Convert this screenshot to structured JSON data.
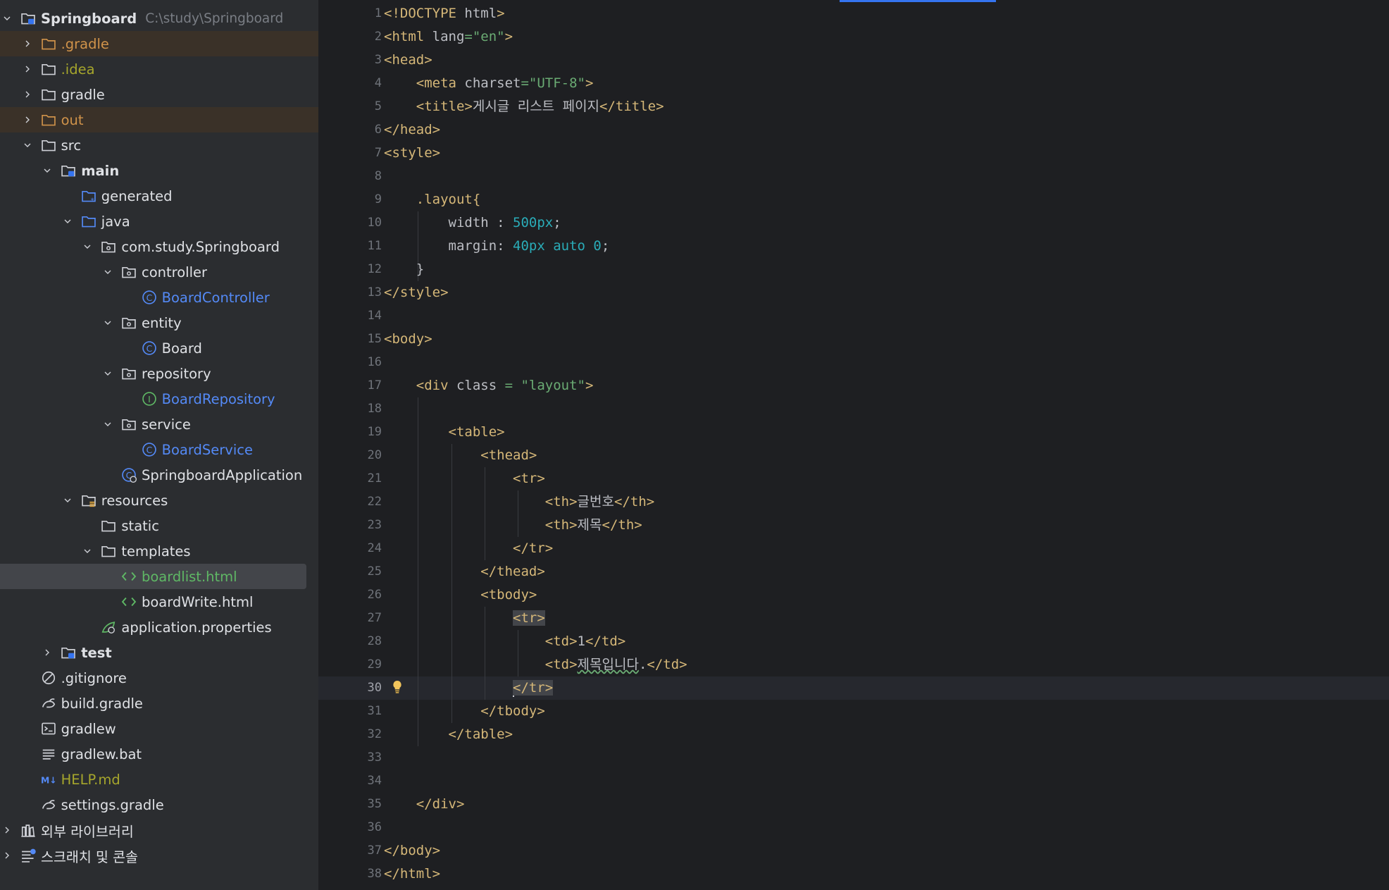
{
  "project_tree": [
    {
      "label": "Springboard",
      "path": "C:\\study\\Springboard",
      "indent": 0,
      "expanded": true,
      "icon": "module-folder",
      "bold": true,
      "color": "#dfe1e5"
    },
    {
      "label": ".gradle",
      "indent": 1,
      "expanded": false,
      "icon": "folder-excluded",
      "color": "#d0934a",
      "ignored": true
    },
    {
      "label": ".idea",
      "indent": 1,
      "expanded": false,
      "icon": "folder",
      "color": "#a6a62c"
    },
    {
      "label": "gradle",
      "indent": 1,
      "expanded": false,
      "icon": "folder",
      "color": "#dfe1e5"
    },
    {
      "label": "out",
      "indent": 1,
      "expanded": false,
      "icon": "folder-excluded",
      "color": "#d0934a",
      "ignored": true
    },
    {
      "label": "src",
      "indent": 1,
      "expanded": true,
      "icon": "folder",
      "color": "#dfe1e5"
    },
    {
      "label": "main",
      "indent": 2,
      "expanded": true,
      "icon": "module-folder",
      "bold": true,
      "color": "#dfe1e5"
    },
    {
      "label": "generated",
      "indent": 3,
      "leaf": true,
      "icon": "source-folder-generated",
      "color": "#dfe1e5"
    },
    {
      "label": "java",
      "indent": 3,
      "expanded": true,
      "icon": "source-folder",
      "color": "#dfe1e5"
    },
    {
      "label": "com.study.Springboard",
      "indent": 4,
      "expanded": true,
      "icon": "package",
      "color": "#dfe1e5"
    },
    {
      "label": "controller",
      "indent": 5,
      "expanded": true,
      "icon": "package",
      "color": "#dfe1e5"
    },
    {
      "label": "BoardController",
      "indent": 6,
      "leaf": true,
      "icon": "class",
      "color": "#548af7"
    },
    {
      "label": "entity",
      "indent": 5,
      "expanded": true,
      "icon": "package",
      "color": "#dfe1e5"
    },
    {
      "label": "Board",
      "indent": 6,
      "leaf": true,
      "icon": "class",
      "color": "#dfe1e5"
    },
    {
      "label": "repository",
      "indent": 5,
      "expanded": true,
      "icon": "package",
      "color": "#dfe1e5"
    },
    {
      "label": "BoardRepository",
      "indent": 6,
      "leaf": true,
      "icon": "interface",
      "color": "#548af7"
    },
    {
      "label": "service",
      "indent": 5,
      "expanded": true,
      "icon": "package",
      "color": "#dfe1e5"
    },
    {
      "label": "BoardService",
      "indent": 6,
      "leaf": true,
      "icon": "class",
      "color": "#548af7"
    },
    {
      "label": "SpringboardApplication",
      "indent": 5,
      "leaf": true,
      "icon": "spring-app-class",
      "color": "#dfe1e5"
    },
    {
      "label": "resources",
      "indent": 3,
      "expanded": true,
      "icon": "resources-folder",
      "color": "#dfe1e5"
    },
    {
      "label": "static",
      "indent": 4,
      "leaf": true,
      "icon": "folder",
      "color": "#dfe1e5"
    },
    {
      "label": "templates",
      "indent": 4,
      "expanded": true,
      "icon": "folder",
      "color": "#dfe1e5"
    },
    {
      "label": "boardlist.html",
      "indent": 5,
      "leaf": true,
      "icon": "html-file",
      "color": "#5fb865",
      "selected": true
    },
    {
      "label": "boardWrite.html",
      "indent": 5,
      "leaf": true,
      "icon": "html-file",
      "color": "#dfe1e5"
    },
    {
      "label": "application.properties",
      "indent": 4,
      "leaf": true,
      "icon": "properties-file",
      "color": "#dfe1e5"
    },
    {
      "label": "test",
      "indent": 2,
      "expanded": false,
      "icon": "module-folder",
      "bold": true,
      "color": "#dfe1e5"
    },
    {
      "label": ".gitignore",
      "indent": 1,
      "leaf": true,
      "icon": "ignore-file",
      "color": "#dfe1e5"
    },
    {
      "label": "build.gradle",
      "indent": 1,
      "leaf": true,
      "icon": "gradle-file",
      "color": "#dfe1e5"
    },
    {
      "label": "gradlew",
      "indent": 1,
      "leaf": true,
      "icon": "shell-file",
      "color": "#dfe1e5"
    },
    {
      "label": "gradlew.bat",
      "indent": 1,
      "leaf": true,
      "icon": "text-file",
      "color": "#dfe1e5"
    },
    {
      "label": "HELP.md",
      "indent": 1,
      "leaf": true,
      "icon": "markdown-file",
      "color": "#a6a62c"
    },
    {
      "label": "settings.gradle",
      "indent": 1,
      "leaf": true,
      "icon": "gradle-file",
      "color": "#dfe1e5"
    },
    {
      "label": "외부 라이브러리",
      "indent": 0,
      "expanded": false,
      "icon": "library",
      "color": "#dfe1e5"
    },
    {
      "label": "스크래치 및 콘솔",
      "indent": 0,
      "expanded": false,
      "icon": "scratches",
      "color": "#dfe1e5"
    }
  ],
  "editor": {
    "current_line": 30,
    "lines": [
      [
        [
          "t",
          "<!DOCTYPE "
        ],
        [
          "a",
          "html"
        ],
        [
          "t",
          ">"
        ]
      ],
      [
        [
          "t",
          "<html "
        ],
        [
          "a",
          "lang"
        ],
        [
          "s",
          "=\"en\""
        ],
        [
          "t",
          ">"
        ]
      ],
      [
        [
          "t",
          "<head>"
        ]
      ],
      [
        [
          "x",
          "    "
        ],
        [
          "t",
          "<meta "
        ],
        [
          "a",
          "charset"
        ],
        [
          "s",
          "=\"UTF-8\""
        ],
        [
          "t",
          ">"
        ]
      ],
      [
        [
          "x",
          "    "
        ],
        [
          "t",
          "<title>"
        ],
        [
          "a",
          "게시글 리스트 페이지"
        ],
        [
          "t",
          "</title>"
        ]
      ],
      [
        [
          "t",
          "</head>"
        ]
      ],
      [
        [
          "t",
          "<style>"
        ]
      ],
      [],
      [
        [
          "x",
          "    "
        ],
        [
          "t",
          ".layout{"
        ]
      ],
      [
        [
          "x",
          "        "
        ],
        [
          "a",
          "width : "
        ],
        [
          "n",
          "500px"
        ],
        [
          "a",
          ";"
        ]
      ],
      [
        [
          "x",
          "        "
        ],
        [
          "a",
          "margin: "
        ],
        [
          "n",
          "40px auto 0"
        ],
        [
          "a",
          ";"
        ]
      ],
      [
        [
          "x",
          "    "
        ],
        [
          "a",
          "}"
        ]
      ],
      [
        [
          "t",
          "</style>"
        ]
      ],
      [],
      [
        [
          "t",
          "<body>"
        ]
      ],
      [],
      [
        [
          "x",
          "    "
        ],
        [
          "t",
          "<div "
        ],
        [
          "a",
          "class "
        ],
        [
          "s",
          "= \"layout\""
        ],
        [
          "t",
          ">"
        ]
      ],
      [],
      [
        [
          "x",
          "        "
        ],
        [
          "t",
          "<table>"
        ]
      ],
      [
        [
          "x",
          "            "
        ],
        [
          "t",
          "<thead>"
        ]
      ],
      [
        [
          "x",
          "                "
        ],
        [
          "t",
          "<tr>"
        ]
      ],
      [
        [
          "x",
          "                    "
        ],
        [
          "t",
          "<th>"
        ],
        [
          "a",
          "글번호"
        ],
        [
          "t",
          "</th>"
        ]
      ],
      [
        [
          "x",
          "                    "
        ],
        [
          "t",
          "<th>"
        ],
        [
          "a",
          "제목"
        ],
        [
          "t",
          "</th>"
        ]
      ],
      [
        [
          "x",
          "                "
        ],
        [
          "t",
          "</tr>"
        ]
      ],
      [
        [
          "x",
          "            "
        ],
        [
          "t",
          "</thead>"
        ]
      ],
      [
        [
          "x",
          "            "
        ],
        [
          "t",
          "<tbody>"
        ]
      ],
      [
        [
          "x",
          "                "
        ],
        [
          "th",
          "<tr>"
        ]
      ],
      [
        [
          "x",
          "                    "
        ],
        [
          "t",
          "<td>"
        ],
        [
          "a",
          "1"
        ],
        [
          "t",
          "</td>"
        ]
      ],
      [
        [
          "x",
          "                    "
        ],
        [
          "t",
          "<td>"
        ],
        [
          "w",
          "제목입니다"
        ],
        [
          "a",
          "."
        ],
        [
          "t",
          "</td>"
        ]
      ],
      [
        [
          "x",
          "                "
        ],
        [
          "caret",
          ""
        ],
        [
          "th",
          "</tr>"
        ]
      ],
      [
        [
          "x",
          "            "
        ],
        [
          "t",
          "</tbody>"
        ]
      ],
      [
        [
          "x",
          "        "
        ],
        [
          "t",
          "</table>"
        ]
      ],
      [],
      [],
      [
        [
          "x",
          "    "
        ],
        [
          "t",
          "</div>"
        ]
      ],
      [],
      [
        [
          "t",
          "</body>"
        ]
      ],
      [
        [
          "t",
          "</html>"
        ]
      ]
    ]
  }
}
